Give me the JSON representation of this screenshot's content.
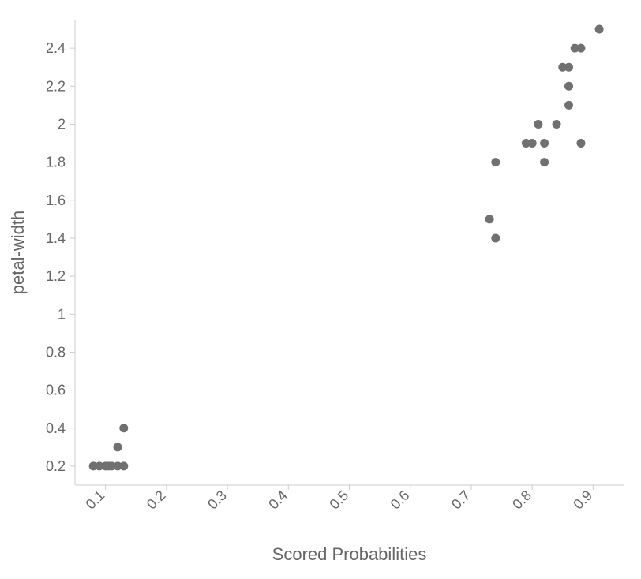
{
  "chart_data": {
    "type": "scatter",
    "xlabel": "Scored Probabilities",
    "ylabel": "petal-width",
    "xlim": [
      0.05,
      0.95
    ],
    "ylim": [
      0.1,
      2.55
    ],
    "xticks": [
      0.1,
      0.2,
      0.3,
      0.4,
      0.5,
      0.6,
      0.7,
      0.8,
      0.9
    ],
    "yticks": [
      0.2,
      0.4,
      0.6,
      0.8,
      1,
      1.2,
      1.4,
      1.6,
      1.8,
      2,
      2.2,
      2.4
    ],
    "points": [
      {
        "x": 0.08,
        "y": 0.2
      },
      {
        "x": 0.09,
        "y": 0.2
      },
      {
        "x": 0.1,
        "y": 0.2
      },
      {
        "x": 0.105,
        "y": 0.2
      },
      {
        "x": 0.11,
        "y": 0.2
      },
      {
        "x": 0.12,
        "y": 0.2
      },
      {
        "x": 0.13,
        "y": 0.2
      },
      {
        "x": 0.12,
        "y": 0.3
      },
      {
        "x": 0.13,
        "y": 0.4
      },
      {
        "x": 0.73,
        "y": 1.5
      },
      {
        "x": 0.74,
        "y": 1.4
      },
      {
        "x": 0.74,
        "y": 1.8
      },
      {
        "x": 0.79,
        "y": 1.9
      },
      {
        "x": 0.8,
        "y": 1.9
      },
      {
        "x": 0.81,
        "y": 2.0
      },
      {
        "x": 0.82,
        "y": 1.8
      },
      {
        "x": 0.82,
        "y": 1.9
      },
      {
        "x": 0.84,
        "y": 2.0
      },
      {
        "x": 0.85,
        "y": 2.3
      },
      {
        "x": 0.86,
        "y": 2.1
      },
      {
        "x": 0.86,
        "y": 2.2
      },
      {
        "x": 0.86,
        "y": 2.3
      },
      {
        "x": 0.87,
        "y": 2.4
      },
      {
        "x": 0.88,
        "y": 2.4
      },
      {
        "x": 0.88,
        "y": 1.9
      },
      {
        "x": 0.91,
        "y": 2.5
      }
    ],
    "dot_color": "#707070",
    "dot_radius": 5.5
  }
}
